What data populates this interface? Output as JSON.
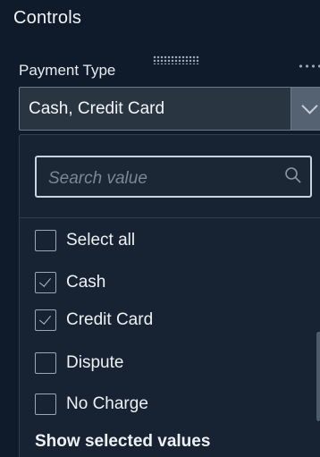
{
  "panel": {
    "title": "Controls"
  },
  "control": {
    "label": "Payment Type",
    "selected_value": "Cash, Credit Card"
  },
  "search": {
    "placeholder": "Search value"
  },
  "options": [
    {
      "label": "Select all",
      "checked": false
    },
    {
      "label": "Cash",
      "checked": true
    },
    {
      "label": "Credit Card",
      "checked": true
    },
    {
      "label": "Dispute",
      "checked": false
    },
    {
      "label": "No Charge",
      "checked": false
    }
  ],
  "footer": {
    "show_selected_label": "Show selected values"
  },
  "icons": {
    "drag": "drag-handle-icon",
    "more": "more-options-icon",
    "chevron": "chevron-down-icon",
    "search": "search-icon"
  },
  "colors": {
    "background": "#0f1b2a",
    "select_bg": "#2a3542",
    "dropdown_bg": "#172332"
  }
}
